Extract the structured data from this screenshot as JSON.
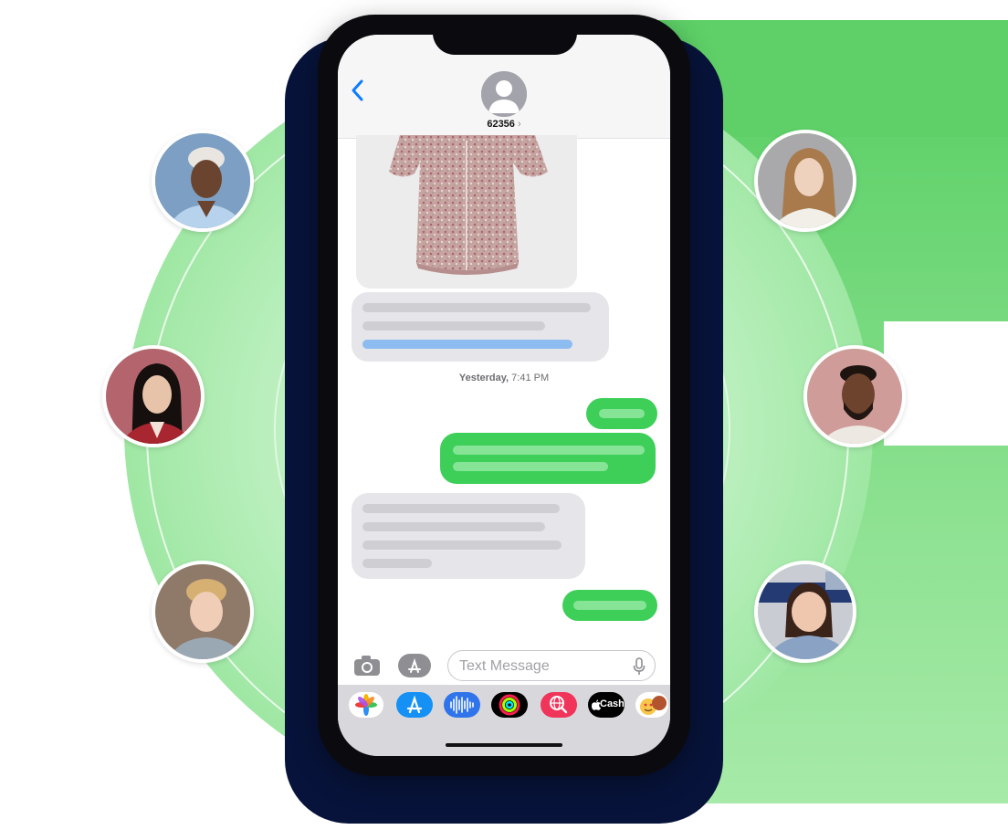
{
  "contact": {
    "name": "62356",
    "chevron": "›"
  },
  "conversation": {
    "timestamp_day": "Yesterday,",
    "timestamp_time": " 7:41 PM"
  },
  "composer": {
    "placeholder": "Text Message"
  },
  "app_tray": {
    "apple_cash_label": "Cash"
  },
  "icons": {
    "back": "chevron-left-icon",
    "contact": "person-silhouette-icon",
    "camera": "camera-icon",
    "apps": "app-store-icon",
    "mic": "microphone-icon"
  },
  "colors": {
    "outgoing_bubble": "#3ecf59",
    "incoming_bubble": "#e6e6ea",
    "link_bar": "#8cbcf0",
    "ios_blue": "#0a7cff",
    "brand_green": "#5ed067",
    "navy": "#07133a"
  }
}
